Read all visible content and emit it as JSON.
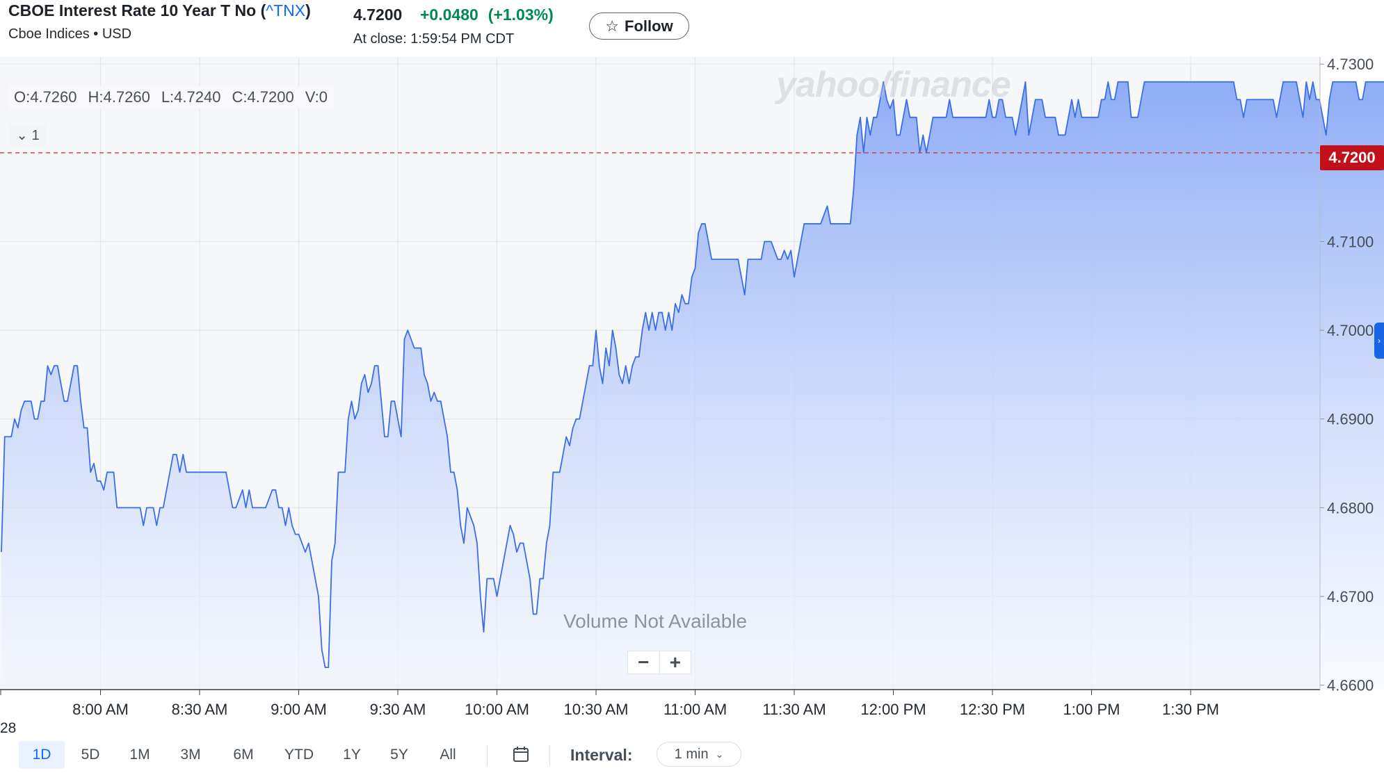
{
  "header": {
    "title": "CBOE Interest Rate 10 Year T No (",
    "symbol": "^TNX",
    "title_close": ")",
    "subtitle": "Cboe Indices • USD",
    "price": "4.7200",
    "change": "+0.0480",
    "change_pct": "(+1.03%)",
    "close_info": "At close: 1:59:54 PM CDT",
    "follow_label": "Follow",
    "follow_icon": "star-icon"
  },
  "ohlc": {
    "open": "O:4.7260",
    "high": "H:4.7260",
    "low": "L:4.7240",
    "close": "C:4.7200",
    "volume": "V:0"
  },
  "series_toggle": "⌄ 1",
  "watermark": "yahoo/finance",
  "volume_note": "Volume Not Available",
  "zoom": {
    "minus": "−",
    "plus": "+"
  },
  "last_price_tag": "4.7200",
  "date_label": "28",
  "range_buttons": [
    "1D",
    "5D",
    "1M",
    "6M",
    "YTD",
    "1Y",
    "5Y",
    "All"
  ],
  "range_extra": "3M",
  "active_range": "1D",
  "interval": {
    "label": "Interval:",
    "value": "1 min"
  },
  "colors": {
    "line": "#3a6ee8",
    "fill_top": "#8fadf6",
    "fill_bottom": "#f2f6ff",
    "positive": "#008a52",
    "last_tag": "#c3111b",
    "accent": "#0f69ff"
  },
  "chart_data": {
    "type": "area",
    "title": "CBOE Interest Rate 10 Year T No (^TNX)",
    "xlabel": "",
    "ylabel": "",
    "x_start": "7:30 AM",
    "x_interval_minutes": 1,
    "x_tick_labels": [
      "8:00 AM",
      "8:30 AM",
      "9:00 AM",
      "9:30 AM",
      "10:00 AM",
      "10:30 AM",
      "11:00 AM",
      "11:30 AM",
      "12:00 PM",
      "12:30 PM",
      "1:00 PM",
      "1:30 PM"
    ],
    "y_tick_labels": [
      "4.7300",
      "4.7100",
      "4.7000",
      "4.6900",
      "4.6800",
      "4.6700",
      "4.6600"
    ],
    "ylim": [
      4.6595,
      4.7308
    ],
    "reference_line": 4.72,
    "grid": true,
    "series": [
      {
        "values": [
          4.675,
          4.688,
          4.688,
          4.688,
          4.69,
          4.689,
          4.691,
          4.692,
          4.692,
          4.692,
          4.69,
          4.69,
          4.692,
          4.692,
          4.696,
          4.695,
          4.696,
          4.696,
          4.694,
          4.692,
          4.692,
          4.694,
          4.696,
          4.696,
          4.692,
          4.689,
          4.689,
          4.684,
          4.685,
          4.683,
          4.683,
          4.682,
          4.684,
          4.684,
          4.684,
          4.68,
          4.68,
          4.68,
          4.68,
          4.68,
          4.68,
          4.68,
          4.68,
          4.678,
          4.68,
          4.68,
          4.68,
          4.678,
          4.68,
          4.68,
          4.682,
          4.684,
          4.686,
          4.686,
          4.684,
          4.686,
          4.684,
          4.684,
          4.684,
          4.684,
          4.684,
          4.684,
          4.684,
          4.684,
          4.684,
          4.684,
          4.684,
          4.684,
          4.684,
          4.682,
          4.68,
          4.68,
          4.681,
          4.682,
          4.68,
          4.682,
          4.68,
          4.68,
          4.68,
          4.68,
          4.68,
          4.681,
          4.682,
          4.682,
          4.68,
          4.68,
          4.678,
          4.68,
          4.678,
          4.677,
          4.677,
          4.676,
          4.675,
          4.676,
          4.674,
          4.672,
          4.67,
          4.664,
          4.662,
          4.662,
          4.674,
          4.676,
          4.684,
          4.684,
          4.684,
          4.69,
          4.692,
          4.69,
          4.691,
          4.694,
          4.695,
          4.693,
          4.694,
          4.696,
          4.696,
          4.692,
          4.688,
          4.688,
          4.692,
          4.692,
          4.69,
          4.688,
          4.699,
          4.7,
          4.699,
          4.698,
          4.698,
          4.698,
          4.695,
          4.694,
          4.692,
          4.693,
          4.692,
          4.692,
          4.69,
          4.688,
          4.684,
          4.684,
          4.682,
          4.678,
          4.676,
          4.68,
          4.679,
          4.678,
          4.676,
          4.67,
          4.666,
          4.672,
          4.672,
          4.672,
          4.67,
          4.672,
          4.674,
          4.676,
          4.678,
          4.677,
          4.675,
          4.676,
          4.676,
          4.674,
          4.672,
          4.668,
          4.668,
          4.672,
          4.672,
          4.676,
          4.678,
          4.684,
          4.684,
          4.684,
          4.686,
          4.688,
          4.687,
          4.689,
          4.69,
          4.69,
          4.692,
          4.694,
          4.696,
          4.696,
          4.7,
          4.696,
          4.694,
          4.698,
          4.696,
          4.7,
          4.698,
          4.695,
          4.694,
          4.696,
          4.694,
          4.696,
          4.697,
          4.697,
          4.7,
          4.702,
          4.7,
          4.702,
          4.7,
          4.702,
          4.702,
          4.7,
          4.702,
          4.7,
          4.703,
          4.702,
          4.704,
          4.703,
          4.703,
          4.706,
          4.707,
          4.711,
          4.712,
          4.712,
          4.71,
          4.708,
          4.708,
          4.708,
          4.708,
          4.708,
          4.708,
          4.708,
          4.708,
          4.708,
          4.706,
          4.704,
          4.708,
          4.708,
          4.708,
          4.708,
          4.708,
          4.71,
          4.71,
          4.71,
          4.709,
          4.708,
          4.708,
          4.709,
          4.708,
          4.709,
          4.706,
          4.708,
          4.71,
          4.712,
          4.712,
          4.712,
          4.712,
          4.712,
          4.712,
          4.713,
          4.714,
          4.712,
          4.712,
          4.712,
          4.712,
          4.712,
          4.712,
          4.712,
          4.716,
          4.722,
          4.724,
          4.72,
          4.724,
          4.722,
          4.724,
          4.724,
          4.726,
          4.728,
          4.726,
          4.725,
          4.726,
          4.722,
          4.722,
          4.724,
          4.726,
          4.724,
          4.724,
          4.724,
          4.72,
          4.722,
          4.72,
          4.722,
          4.724,
          4.724,
          4.724,
          4.724,
          4.724,
          4.726,
          4.724,
          4.724,
          4.724,
          4.724,
          4.724,
          4.724,
          4.724,
          4.724,
          4.724,
          4.724,
          4.724,
          4.726,
          4.724,
          4.724,
          4.726,
          4.726,
          4.724,
          4.724,
          4.724,
          4.722,
          4.724,
          4.726,
          4.728,
          4.722,
          4.724,
          4.726,
          4.726,
          4.726,
          4.724,
          4.724,
          4.724,
          4.724,
          4.722,
          4.722,
          4.722,
          4.724,
          4.726,
          4.724,
          4.726,
          4.724,
          4.724,
          4.724,
          4.724,
          4.724,
          4.724,
          4.726,
          4.726,
          4.728,
          4.726,
          4.726,
          4.728,
          4.728,
          4.728,
          4.728,
          4.724,
          4.724,
          4.724,
          4.726,
          4.728,
          4.728,
          4.728,
          4.728,
          4.728,
          4.728,
          4.728,
          4.728,
          4.728,
          4.728,
          4.728,
          4.728,
          4.728,
          4.728,
          4.728,
          4.728,
          4.728,
          4.728,
          4.728,
          4.728,
          4.728,
          4.728,
          4.728,
          4.728,
          4.728,
          4.728,
          4.728,
          4.728,
          4.726,
          4.726,
          4.724,
          4.726,
          4.726,
          4.726,
          4.726,
          4.726,
          4.726,
          4.726,
          4.726,
          4.726,
          4.724,
          4.726,
          4.728,
          4.728,
          4.728,
          4.728,
          4.728,
          4.726,
          4.724,
          4.728,
          4.726,
          4.728,
          4.726,
          4.726,
          4.724,
          4.722,
          4.726,
          4.728,
          4.728,
          4.728,
          4.728,
          4.728,
          4.728,
          4.728,
          4.728,
          4.726,
          4.726,
          4.728,
          4.728,
          4.728,
          4.728,
          4.728,
          4.728,
          4.728,
          4.728,
          4.728,
          4.728,
          4.728,
          4.728,
          4.728,
          4.726,
          4.724,
          4.726,
          4.726,
          4.728,
          4.728,
          4.728,
          4.728,
          4.728,
          4.728,
          4.728,
          4.728,
          4.72
        ]
      }
    ]
  }
}
